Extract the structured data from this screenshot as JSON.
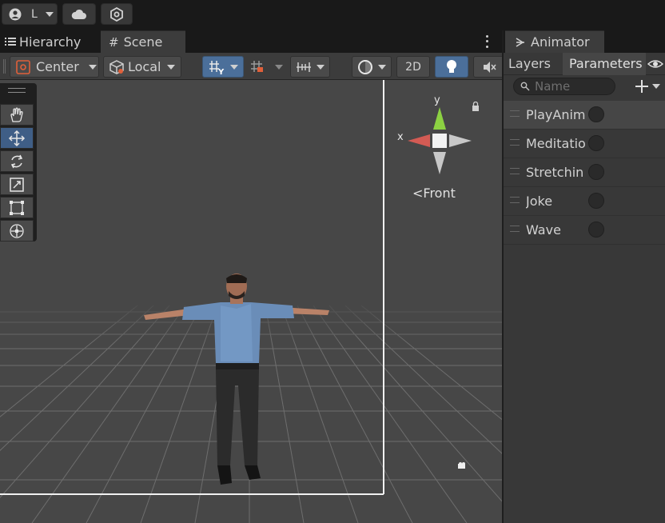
{
  "topbar": {
    "account_label": "L"
  },
  "tabs": {
    "hierarchy": "Hierarchy",
    "scene": "Scene",
    "animator": "Animator"
  },
  "scene_toolbar": {
    "pivot_label": "Center",
    "space_label": "Local",
    "view_2d_label": "2D"
  },
  "gizmo": {
    "y_label": "y",
    "x_label": "x",
    "view_label": "Front"
  },
  "animator": {
    "tab_layers": "Layers",
    "tab_parameters": "Parameters",
    "search_placeholder": "Name",
    "parameters": [
      {
        "label": "PlayAnim"
      },
      {
        "label": "Meditatio"
      },
      {
        "label": "Stretchin"
      },
      {
        "label": "Joke"
      },
      {
        "label": "Wave"
      }
    ]
  },
  "colors": {
    "accent_blue": "#4b6f9a",
    "panel_bg": "#383838",
    "scene_bg": "#474747",
    "gizmo_x": "#d35b54",
    "gizmo_y": "#8cd142"
  }
}
